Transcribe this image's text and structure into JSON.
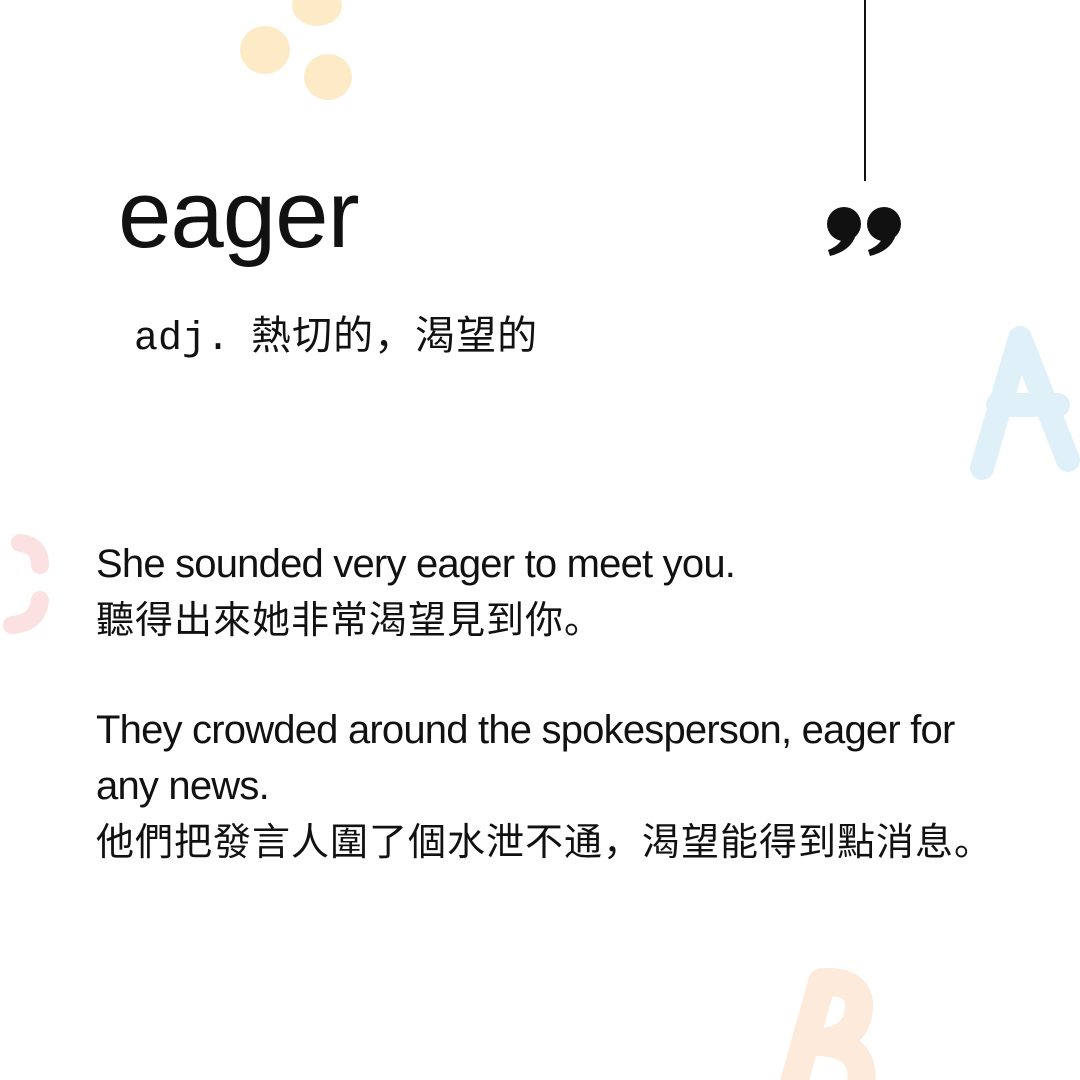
{
  "word": "eager",
  "definition": {
    "part_of_speech": "adj.",
    "meaning": "熱切的，渴望的"
  },
  "examples": [
    {
      "english": "She sounded very eager to meet you.",
      "chinese": "聽得出來她非常渴望見到你。"
    },
    {
      "english": "They crowded around the spokesperson, eager for any news.",
      "chinese": "他們把發言人圍了個水泄不通，渴望能得到點消息。"
    }
  ],
  "decorations": {
    "letters": [
      "A",
      "C",
      "B"
    ],
    "icons": [
      "quote-mark-icon"
    ]
  },
  "colors": {
    "text": "#111111",
    "background": "#ffffff",
    "dots": "#fdebc8",
    "letter_a": "#dff0f9",
    "letter_c": "#fbe1e1",
    "letter_b": "#fdeadb"
  }
}
